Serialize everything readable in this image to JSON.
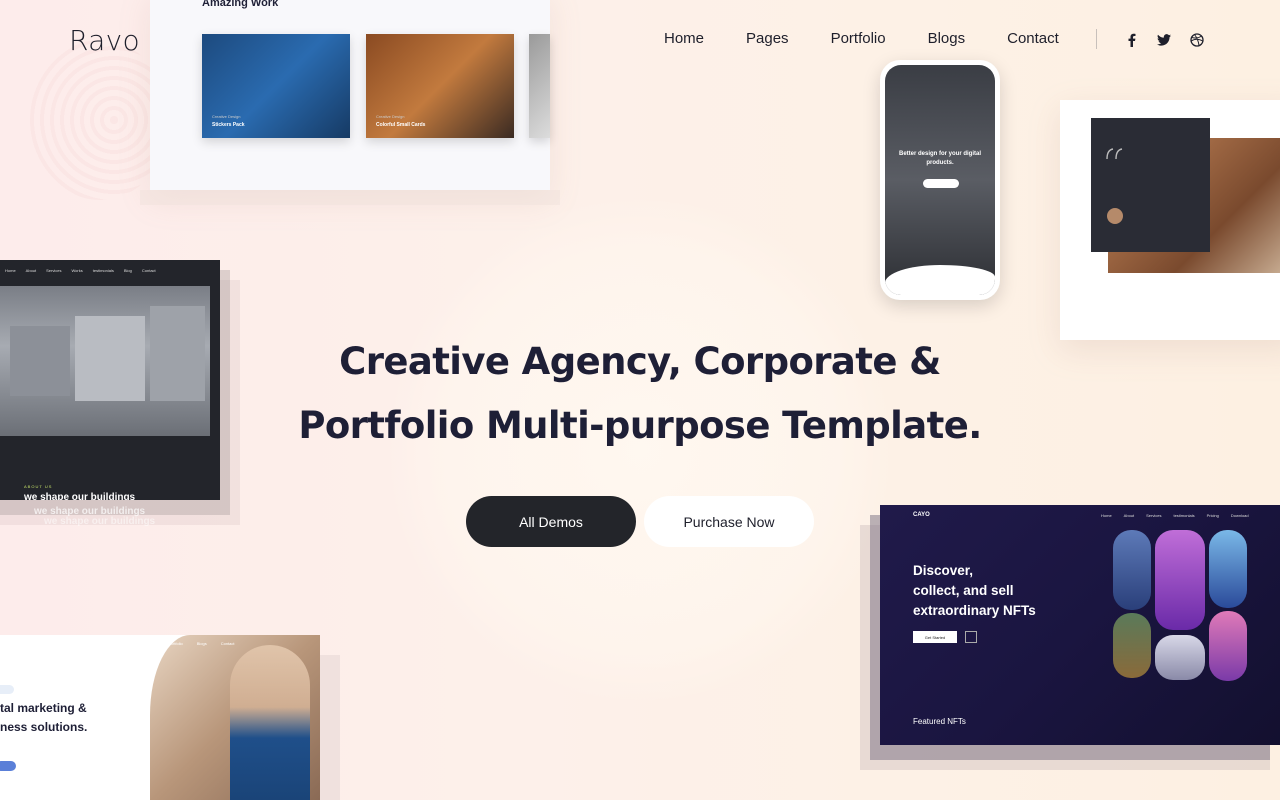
{
  "brand": {
    "logo": "Ravo"
  },
  "nav": {
    "items": [
      "Home",
      "Pages",
      "Portfolio",
      "Blogs",
      "Contact"
    ],
    "social_icons": [
      "facebook-icon",
      "twitter-icon",
      "dribbble-icon"
    ]
  },
  "hero": {
    "title_line1": "Creative Agency, Corporate &",
    "title_line2": "Portfolio Multi-purpose Template.",
    "primary_button": "All Demos",
    "secondary_button": "Purchase Now"
  },
  "previews": {
    "work": {
      "title": "Amazing Work",
      "items": [
        {
          "tag": "Creative Design",
          "name": "Stickers Pack"
        },
        {
          "tag": "Creative Design",
          "name": "Colorful Small Cards"
        }
      ]
    },
    "phone": {
      "headline": "Better design for your digital products."
    },
    "architecture": {
      "nav": [
        "Home",
        "About",
        "Services",
        "Works",
        "testimonials",
        "Blog",
        "Contact"
      ],
      "label": "ABOUT US",
      "heading": "we shape our buildings"
    },
    "marketing": {
      "nav": [
        "Home",
        "Pages",
        "Portfolio",
        "Blogs",
        "Contact"
      ],
      "heading_line1": "tal marketing &",
      "heading_line2": "ness solutions."
    },
    "nft": {
      "logo": "CAYO",
      "nav": [
        "Home",
        "About",
        "Services",
        "testimonials",
        "Pricing",
        "Download"
      ],
      "heading_line1": "Discover,",
      "heading_line2": "collect, and sell",
      "heading_line3": "extraordinary NFTs",
      "button": "Get Started",
      "featured": "Featured NFTs"
    }
  },
  "colors": {
    "dark": "#23252a",
    "heading": "#1e1f36",
    "nft_bg": "#1a1540"
  }
}
